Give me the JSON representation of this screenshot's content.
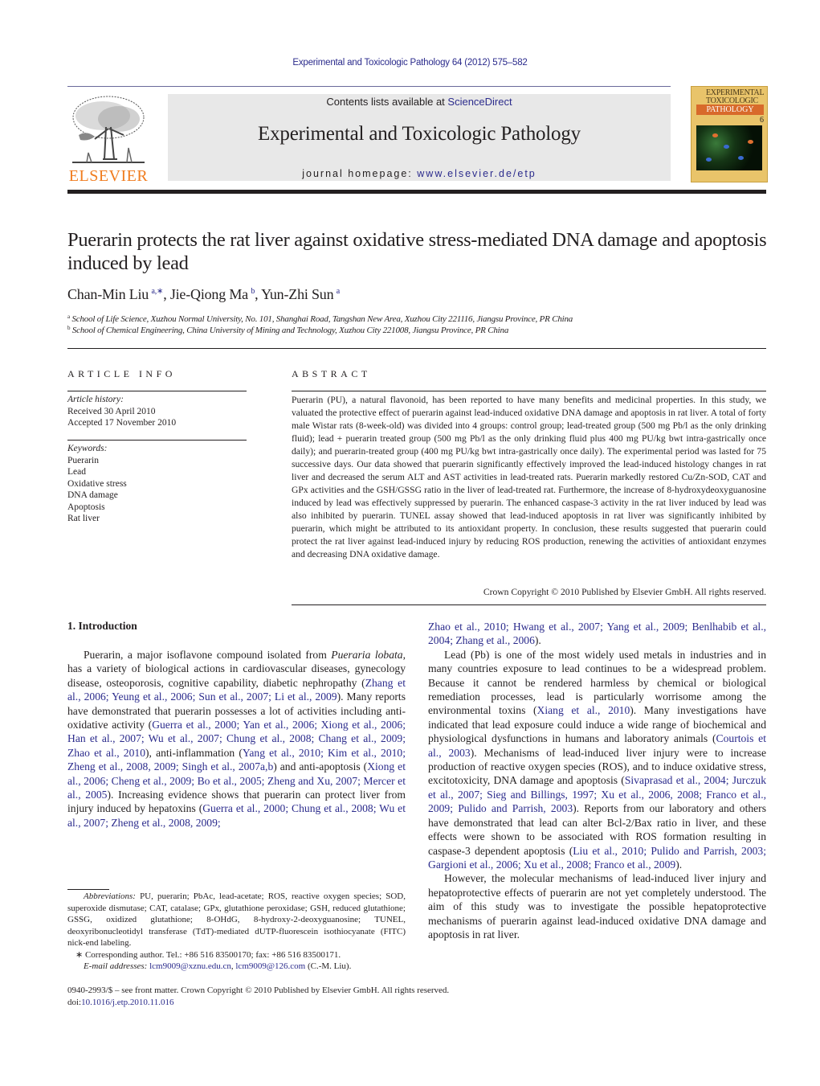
{
  "running_head": "Experimental and Toxicologic Pathology 64 (2012) 575–582",
  "masthead": {
    "publisher_logo_text": "ELSEVIER",
    "contents_prefix": "Contents lists available at ",
    "contents_link": "ScienceDirect",
    "journal_title": "Experimental and Toxicologic Pathology",
    "homepage_prefix": "journal homepage: ",
    "homepage_url": "www.elsevier.de/etp",
    "cover": {
      "line1": "EXPERIMENTAL",
      "line2": "TOXICOLOGIC",
      "line3": "PATHOLOGY",
      "issue": "6"
    }
  },
  "article": {
    "title": "Puerarin protects the rat liver against oxidative stress-mediated DNA damage and apoptosis induced by lead",
    "authors": [
      {
        "name": "Chan-Min Liu",
        "sup": "a,∗"
      },
      {
        "name": "Jie-Qiong Ma",
        "sup": "b"
      },
      {
        "name": "Yun-Zhi Sun",
        "sup": "a"
      }
    ],
    "affiliations": [
      {
        "sup": "a",
        "text": "School of Life Science, Xuzhou Normal University, No. 101, Shanghai Road, Tangshan New Area, Xuzhou City 221116, Jiangsu Province, PR China"
      },
      {
        "sup": "b",
        "text": "School of Chemical Engineering, China University of Mining and Technology, Xuzhou City 221008, Jiangsu Province, PR China"
      }
    ]
  },
  "article_info": {
    "heading": "ARTICLE INFO",
    "history_label": "Article history:",
    "received": "Received 30 April 2010",
    "accepted": "Accepted 17 November 2010",
    "keywords_label": "Keywords:",
    "keywords": [
      "Puerarin",
      "Lead",
      "Oxidative stress",
      "DNA damage",
      "Apoptosis",
      "Rat liver"
    ]
  },
  "abstract": {
    "heading": "ABSTRACT",
    "text": "Puerarin (PU), a natural flavonoid, has been reported to have many benefits and medicinal properties. In this study, we valuated the protective effect of puerarin against lead-induced oxidative DNA damage and apoptosis in rat liver. A total of forty male Wistar rats (8-week-old) was divided into 4 groups: control group; lead-treated group (500 mg Pb/l as the only drinking fluid); lead + puerarin treated group (500 mg Pb/l as the only drinking fluid plus 400 mg PU/kg bwt intra-gastrically once daily); and puerarin-treated group (400 mg PU/kg bwt intra-gastrically once daily). The experimental period was lasted for 75 successive days. Our data showed that puerarin significantly effectively improved the lead-induced histology changes in rat liver and decreased the serum ALT and AST activities in lead-treated rats. Puerarin markedly restored Cu/Zn-SOD, CAT and GPx activities and the GSH/GSSG ratio in the liver of lead-treated rat. Furthermore, the increase of 8-hydroxydeoxyguanosine induced by lead was effectively suppressed by puerarin. The enhanced caspase-3 activity in the rat liver induced by lead was also inhibited by puerarin. TUNEL assay showed that lead-induced apoptosis in rat liver was significantly inhibited by puerarin, which might be attributed to its antioxidant property. In conclusion, these results suggested that puerarin could protect the rat liver against lead-induced injury by reducing ROS production, renewing the activities of antioxidant enzymes and decreasing DNA oxidative damage.",
    "copyright": "Crown Copyright © 2010 Published by Elsevier GmbH. All rights reserved."
  },
  "introduction": {
    "heading": "1.  Introduction",
    "left_column": [
      {
        "t": "Puerarin, a major isoflavone compound isolated from "
      },
      {
        "t": "Pueraria lobata",
        "style": "italic"
      },
      {
        "t": ", has a variety of biological actions in cardiovascular diseases, gynecology disease, osteoporosis, cognitive capability, diabetic nephropathy ("
      },
      {
        "t": "Zhang et al., 2006; Yeung et al., 2006; Sun et al., 2007; Li et al., 2009",
        "style": "link"
      },
      {
        "t": "). Many reports have demonstrated that puerarin possesses a lot of activities including anti-oxidative activity ("
      },
      {
        "t": "Guerra et al., 2000; Yan et al., 2006; Xiong et al., 2006; Han et al., 2007; Wu et al., 2007; Chung et al., 2008; Chang et al., 2009; Zhao et al., 2010",
        "style": "link"
      },
      {
        "t": "), anti-inflammation ("
      },
      {
        "t": "Yang et al., 2010; Kim et al., 2010; Zheng et al., 2008, 2009; Singh et al., 2007a,b",
        "style": "link"
      },
      {
        "t": ") and anti-apoptosis ("
      },
      {
        "t": "Xiong et al., 2006; Cheng et al., 2009; Bo et al., 2005; Zheng and Xu, 2007; Mercer et al., 2005",
        "style": "link"
      },
      {
        "t": "). Increasing evidence shows that puerarin can protect liver from injury induced by hepatoxins ("
      },
      {
        "t": "Guerra et al., 2000; Chung et al., 2008; Wu et al., 2007; Zheng et al., 2008, 2009;",
        "style": "link"
      }
    ],
    "right_column_cont": [
      {
        "t": "Zhao et al., 2010; Hwang et al., 2007; Yang et al., 2009; Benlhabib et al., 2004; Zhang et al., 2006",
        "style": "link"
      },
      {
        "t": ")."
      }
    ],
    "right_p2": [
      {
        "t": "Lead (Pb) is one of the most widely used metals in industries and in many countries exposure to lead continues to be a widespread problem. Because it cannot be rendered harmless by chemical or biological remediation processes, lead is particularly worrisome among the environmental toxins ("
      },
      {
        "t": "Xiang et al., 2010",
        "style": "link"
      },
      {
        "t": "). Many investigations have indicated that lead exposure could induce a wide range of biochemical and physiological dysfunctions in humans and laboratory animals ("
      },
      {
        "t": "Courtois et al., 2003",
        "style": "link"
      },
      {
        "t": "). Mechanisms of lead-induced liver injury were to increase production of reactive oxygen species (ROS), and to induce oxidative stress, excitotoxicity, DNA damage and apoptosis ("
      },
      {
        "t": "Sivaprasad et al., 2004; Jurczuk et al., 2007; Sieg and Billings, 1997; Xu et al., 2006, 2008; Franco et al., 2009; Pulido and Parrish, 2003",
        "style": "link"
      },
      {
        "t": "). Reports from our laboratory and others have demonstrated that lead can alter Bcl-2/Bax ratio in liver, and these effects were shown to be associated with ROS formation resulting in caspase-3 dependent apoptosis ("
      },
      {
        "t": "Liu et al., 2010; Pulido and Parrish, 2003; Gargioni et al., 2006; Xu et al., 2008; Franco et al., 2009",
        "style": "link"
      },
      {
        "t": ")."
      }
    ],
    "right_p3": "However, the molecular mechanisms of lead-induced liver injury and hepatoprotective effects of puerarin are not yet completely understood. The aim of this study was to investigate the possible hepatoprotective mechanisms of puerarin against lead-induced oxidative DNA damage and apoptosis in rat liver."
  },
  "footnotes": {
    "abbrev_label": "Abbreviations:",
    "abbrev_text": "  PU, puerarin; PbAc, lead-acetate; ROS, reactive oxygen species; SOD, superoxide dismutase; CAT, catalase; GPx, glutathione peroxidase; GSH, reduced glutathione; GSSG, oxidized glutathione; 8-OHdG, 8-hydroxy-2-deoxyguanosine; TUNEL, deoxyribonucleotidyl transferase (TdT)-mediated dUTP-fluorescein isothiocyanate (FITC) nick-end labeling.",
    "corresponding": "∗ Corresponding author. Tel.: +86 516 83500170; fax: +86 516 83500171.",
    "email_label": "E-mail addresses:",
    "email1": "lcm9009@xznu.edu.cn",
    "email2": "lcm9009@126.com",
    "email_suffix": " (C.-M. Liu)."
  },
  "bottom": {
    "issn_line": "0940-2993/$ – see front matter. Crown Copyright © 2010 Published by Elsevier GmbH. All rights reserved.",
    "doi_prefix": "doi:",
    "doi": "10.1016/j.etp.2010.11.016"
  },
  "colors": {
    "link": "#2b2b8c",
    "elsevier_orange": "#f07c1e",
    "banner_gray": "#e8e8e8",
    "text": "#231f20"
  }
}
